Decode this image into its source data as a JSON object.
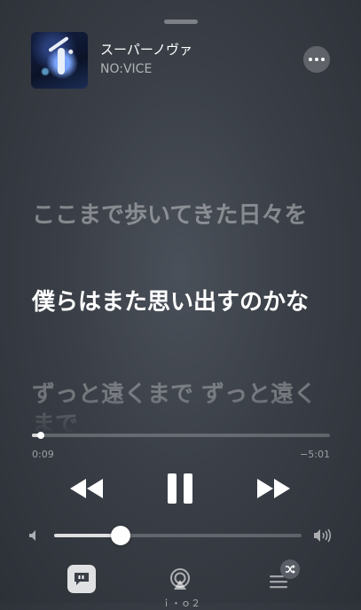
{
  "now_playing": {
    "title": "スーパーノヴァ",
    "artist": "NO:VICE"
  },
  "lyrics": {
    "previous": "ここまで歩いてきた日々を",
    "current": "僕らはまた思い出すのかな",
    "next": "ずっと遠くまで ずっと遠くまで"
  },
  "playback": {
    "elapsed": "0:09",
    "remaining": "−5:01",
    "progress": 0.03,
    "state": "playing"
  },
  "volume": {
    "level": 0.27
  },
  "bottom_bar": {
    "airplay_label": "ｉ・ｏ２"
  },
  "icons": {
    "more": "more-icon",
    "rewind": "rewind-icon",
    "pause": "pause-icon",
    "forward": "fast-forward-icon",
    "volume_min": "speaker-low-icon",
    "volume_max": "speaker-high-icon",
    "lyrics": "lyrics-quote-icon",
    "airplay": "airplay-icon",
    "queue": "queue-list-icon",
    "shuffle": "shuffle-icon"
  }
}
